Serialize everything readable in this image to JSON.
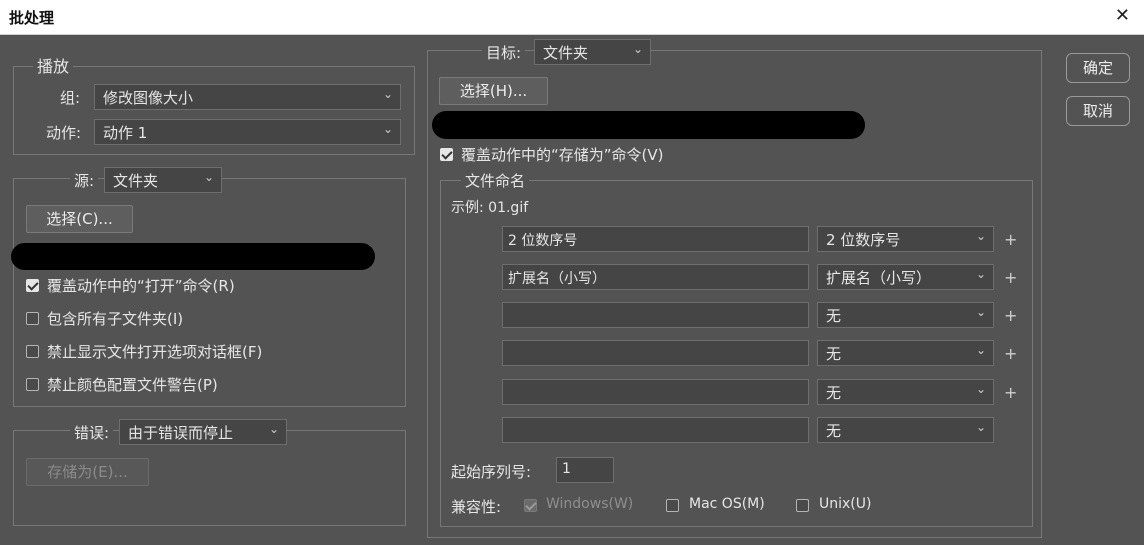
{
  "window": {
    "title": "批处理",
    "close_glyph": "✕"
  },
  "play": {
    "legend": "播放",
    "set_label": "组:",
    "set_value": "修改图像大小",
    "action_label": "动作:",
    "action_value": "动作 1"
  },
  "source": {
    "label": "源:",
    "value": "文件夹",
    "choose_label": "选择(C)...",
    "checkboxes": [
      {
        "label": "覆盖动作中的“打开”命令(R)",
        "checked": true
      },
      {
        "label": "包含所有子文件夹(I)",
        "checked": false
      },
      {
        "label": "禁止显示文件打开选项对话框(F)",
        "checked": false
      },
      {
        "label": "禁止颜色配置文件警告(P)",
        "checked": false
      }
    ]
  },
  "errors": {
    "label": "错误:",
    "value": "由于错误而停止",
    "save_as_label": "存储为(E)..."
  },
  "destination": {
    "label": "目标:",
    "value": "文件夹",
    "choose_label": "选择(H)...",
    "override_label": "覆盖动作中的“存储为”命令(V)",
    "override_checked": true
  },
  "naming": {
    "legend": "文件命名",
    "example": "示例: 01.gif",
    "rows": [
      {
        "text": "2 位数序号",
        "select": "2 位数序号",
        "plus": "+"
      },
      {
        "text": "扩展名（小写）",
        "select": "扩展名（小写）",
        "plus": "+"
      },
      {
        "text": "",
        "select": "无",
        "plus": "+"
      },
      {
        "text": "",
        "select": "无",
        "plus": "+"
      },
      {
        "text": "",
        "select": "无",
        "plus": "+"
      },
      {
        "text": "",
        "select": "无",
        "plus": ""
      }
    ],
    "start_serial_label": "起始序列号:",
    "start_serial_value": "1",
    "compat_label": "兼容性:",
    "compat": [
      {
        "label": "Windows(W)",
        "checked": true,
        "disabled": true
      },
      {
        "label": "Mac OS(M)",
        "checked": false,
        "disabled": false
      },
      {
        "label": "Unix(U)",
        "checked": false,
        "disabled": false
      }
    ]
  },
  "buttons": {
    "ok": "确定",
    "cancel": "取消"
  },
  "icons": {
    "chevron": "chevron-down-icon",
    "close": "close-icon"
  }
}
